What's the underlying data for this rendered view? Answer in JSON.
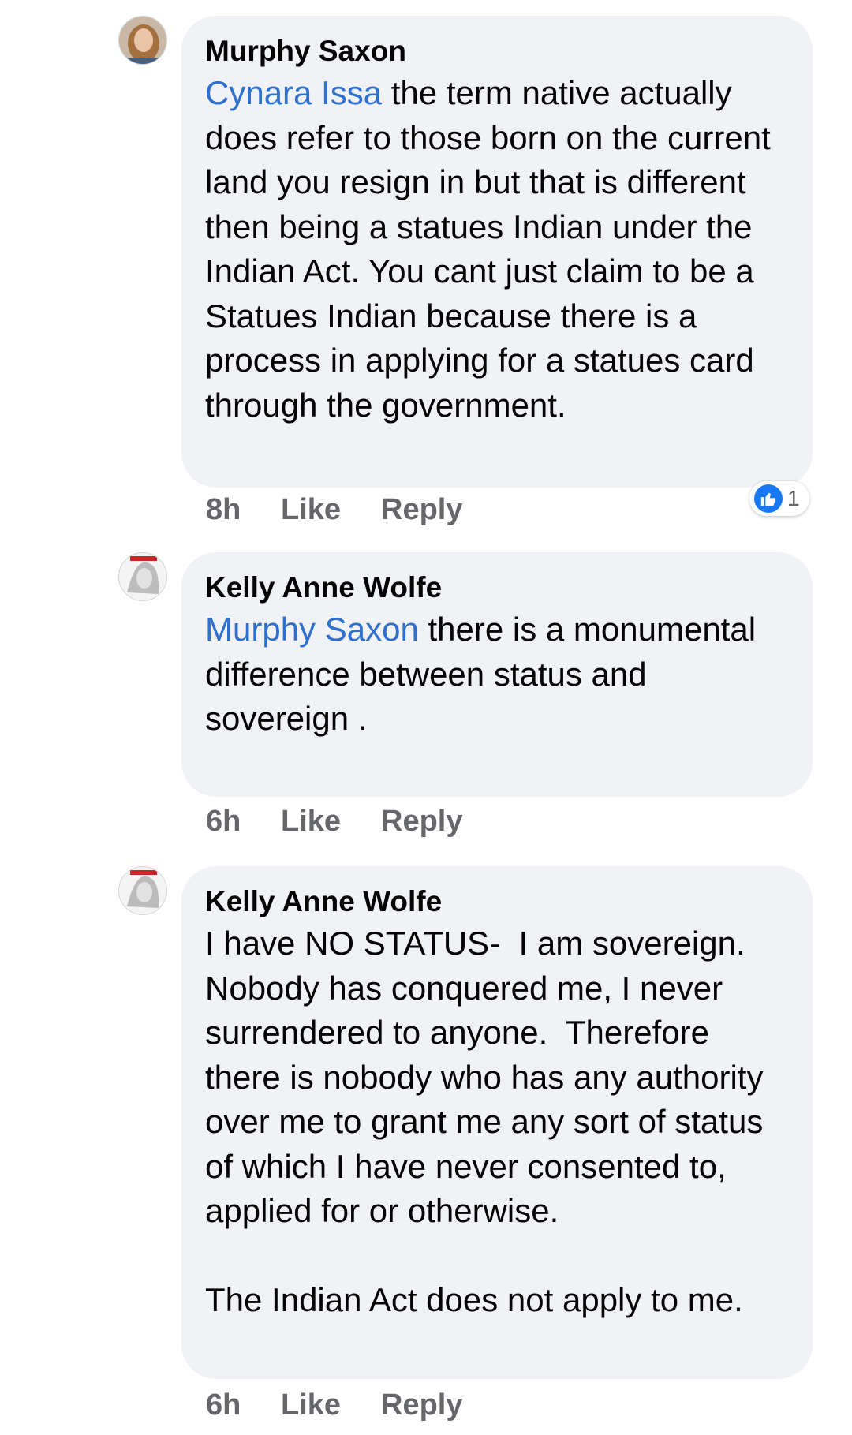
{
  "comments": [
    {
      "author": "Murphy Saxon",
      "mention": "Cynara Issa",
      "text": " the term native actually does refer to those born on the current land you resign in but that is different then being a statues Indian under the Indian Act. You cant just claim to be a Statues Indian because there is a process in applying for a statues card through the government.",
      "time": "8h",
      "like_label": "Like",
      "reply_label": "Reply",
      "reaction_count": "1"
    },
    {
      "author": "Kelly Anne Wolfe",
      "mention": "Murphy Saxon",
      "text": " there is a monumental difference between status and sovereign .",
      "time": "6h",
      "like_label": "Like",
      "reply_label": "Reply"
    },
    {
      "author": "Kelly Anne Wolfe",
      "mention": "",
      "text": "I have NO STATUS-  I am sovereign. Nobody has conquered me, I never surrendered to anyone.  Therefore there is nobody who has any authority over me to grant me any sort of status of which I have never consented to, applied for or otherwise.\n\nThe Indian Act does not apply to me.",
      "time": "6h",
      "like_label": "Like",
      "reply_label": "Reply"
    }
  ]
}
